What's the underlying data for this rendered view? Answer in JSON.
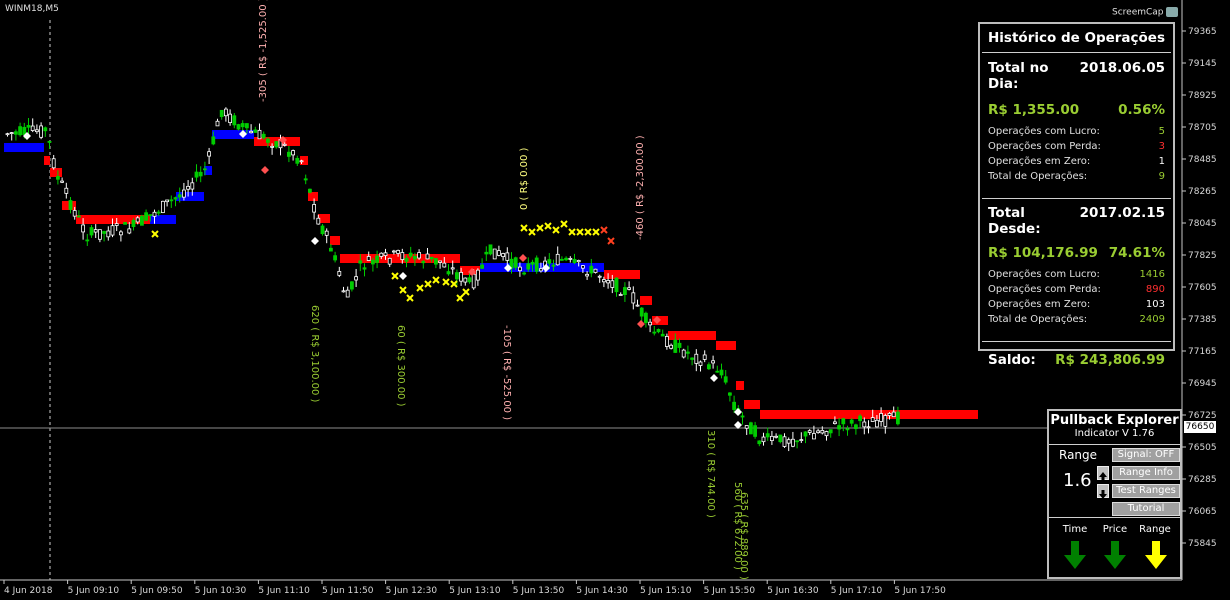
{
  "window": {
    "symbol": "WINM18,M5",
    "screemcap_label": "ScreemCap",
    "current_price": "76650"
  },
  "colors": {
    "trail_red": "#ff0000",
    "trail_blue": "#0000ff",
    "candle_up": "#00cc00",
    "candle_down": "#ffffff",
    "marker_yellow": "#ffff00",
    "annot_green": "#9acd32",
    "annot_pink": "#ffb0b0"
  },
  "price_axis": [
    "79365",
    "79145",
    "78925",
    "78705",
    "78485",
    "78265",
    "78045",
    "77825",
    "77605",
    "77385",
    "77165",
    "76945",
    "76725",
    "76505",
    "76285",
    "76065",
    "75845"
  ],
  "time_axis": [
    "4 Jun 2018",
    "5 Jun 09:10",
    "5 Jun 09:50",
    "5 Jun 10:30",
    "5 Jun 11:10",
    "5 Jun 11:50",
    "5 Jun 12:30",
    "5 Jun 13:10",
    "5 Jun 13:50",
    "5 Jun 14:30",
    "5 Jun 15:10",
    "5 Jun 15:50",
    "5 Jun 16:30",
    "5 Jun 17:10",
    "5 Jun 17:50"
  ],
  "annotations": [
    {
      "text": "-305 ( R$ -1,525.00 )",
      "color": "pink"
    },
    {
      "text": "620 ( R$ 3,100.00 )",
      "color": "green"
    },
    {
      "text": "60 ( R$ 300.00 )",
      "color": "green"
    },
    {
      "text": "0 ( R$ 0.00 )",
      "color": "yellow"
    },
    {
      "text": "-105 ( R$ -525.00 )",
      "color": "pink"
    },
    {
      "text": "-460 ( R$ -2,300.00 )",
      "color": "pink"
    },
    {
      "text": "310 ( R$ 744.00 )",
      "color": "green"
    },
    {
      "text": "560 ( R$ 672.00 )",
      "color": "green"
    },
    {
      "text": "635 ( R$ 889.00 )",
      "color": "green"
    }
  ],
  "history": {
    "title": "Histórico de Operações",
    "day_label": "Total no Dia:",
    "day_date": "2018.06.05",
    "day_amount": "R$ 1,355.00",
    "day_pct": "0.56%",
    "day_stats": [
      {
        "label": "Operações com Lucro:",
        "value": "5",
        "color": "#9acd32"
      },
      {
        "label": "Operações com Perda:",
        "value": "3",
        "color": "#ff3030"
      },
      {
        "label": "Operações em Zero:",
        "value": "1",
        "color": "#ffffff"
      },
      {
        "label": "Total de Operações:",
        "value": "9",
        "color": "#9acd32"
      }
    ],
    "since_label": "Total Desde:",
    "since_date": "2017.02.15",
    "since_amount": "R$ 104,176.99",
    "since_pct": "74.61%",
    "since_stats": [
      {
        "label": "Operações com Lucro:",
        "value": "1416",
        "color": "#9acd32"
      },
      {
        "label": "Operações com Perda:",
        "value": "890",
        "color": "#ff3030"
      },
      {
        "label": "Operações em Zero:",
        "value": "103",
        "color": "#ffffff"
      },
      {
        "label": "Total de Operações:",
        "value": "2409",
        "color": "#9acd32"
      }
    ],
    "balance_label": "Saldo:",
    "balance_value": "R$ 243,806.99"
  },
  "pullback": {
    "title": "Pullback Explorer",
    "subtitle": "Indicator V 1.76",
    "range_label": "Range",
    "range_value": "1.6",
    "signal_btn": "Signal: OFF",
    "range_info_btn": "Range Info",
    "test_ranges_btn": "Test Ranges",
    "tutorial_btn": "Tutorial",
    "time_label": "Time",
    "price_label": "Price",
    "range2_label": "Range",
    "time_arrow_color": "#008000",
    "price_arrow_color": "#008000",
    "range_arrow_color": "#ffff00"
  }
}
